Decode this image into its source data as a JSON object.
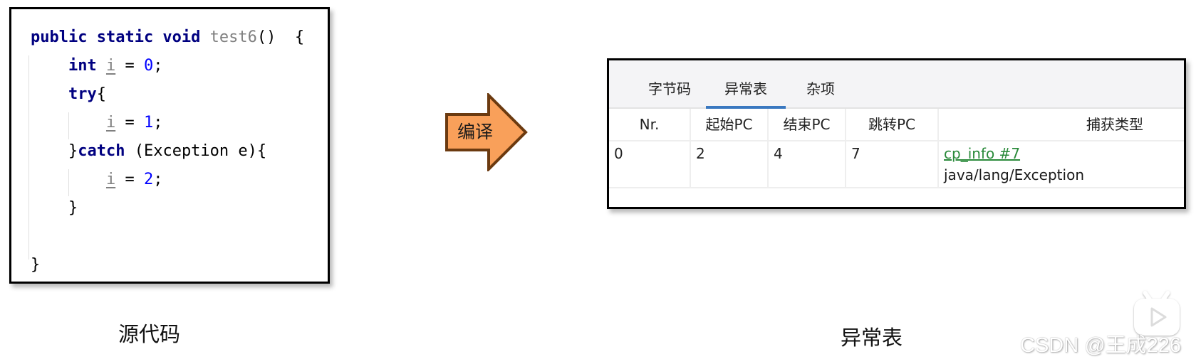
{
  "source_panel": {
    "caption": "源代码",
    "code_lines": [
      [
        {
          "t": "public static void ",
          "c": "kw"
        },
        {
          "t": "test6",
          "c": "fn"
        },
        {
          "t": "()  {",
          "c": ""
        }
      ],
      [
        {
          "t": "    ",
          "c": ""
        },
        {
          "t": "int ",
          "c": "kw"
        },
        {
          "t": "i",
          "c": "var"
        },
        {
          "t": " = ",
          "c": ""
        },
        {
          "t": "0",
          "c": "num"
        },
        {
          "t": ";",
          "c": ""
        }
      ],
      [
        {
          "t": "    ",
          "c": ""
        },
        {
          "t": "try",
          "c": "kw"
        },
        {
          "t": "{",
          "c": ""
        }
      ],
      [
        {
          "t": "        ",
          "c": ""
        },
        {
          "t": "i",
          "c": "var"
        },
        {
          "t": " = ",
          "c": ""
        },
        {
          "t": "1",
          "c": "num"
        },
        {
          "t": ";",
          "c": ""
        }
      ],
      [
        {
          "t": "    }",
          "c": ""
        },
        {
          "t": "catch",
          "c": "kw"
        },
        {
          "t": " (Exception e){",
          "c": ""
        }
      ],
      [
        {
          "t": "        ",
          "c": ""
        },
        {
          "t": "i",
          "c": "var"
        },
        {
          "t": " = ",
          "c": ""
        },
        {
          "t": "2",
          "c": "num"
        },
        {
          "t": ";",
          "c": ""
        }
      ],
      [
        {
          "t": "    }",
          "c": ""
        }
      ],
      [
        {
          "t": "",
          "c": ""
        }
      ],
      [
        {
          "t": "}",
          "c": ""
        }
      ]
    ]
  },
  "arrow": {
    "label": "编译",
    "fill_color": "#F9A05A",
    "stroke_color": "#6B3A10"
  },
  "exception_panel": {
    "caption": "异常表",
    "tabs": [
      {
        "label": "字节码",
        "active": false
      },
      {
        "label": "异常表",
        "active": true
      },
      {
        "label": "杂项",
        "active": false
      }
    ],
    "columns": [
      "Nr.",
      "起始PC",
      "结束PC",
      "跳转PC",
      "捕获类型"
    ],
    "rows": [
      {
        "nr": "0",
        "start_pc": "2",
        "end_pc": "4",
        "handler_pc": "7",
        "catch_type_link": "cp_info #7",
        "catch_type_name": "java/lang/Exception"
      }
    ],
    "accent_color": "#3A78C0",
    "link_color": "#2A8A3A"
  },
  "watermark": {
    "text": "CSDN @王成226"
  }
}
